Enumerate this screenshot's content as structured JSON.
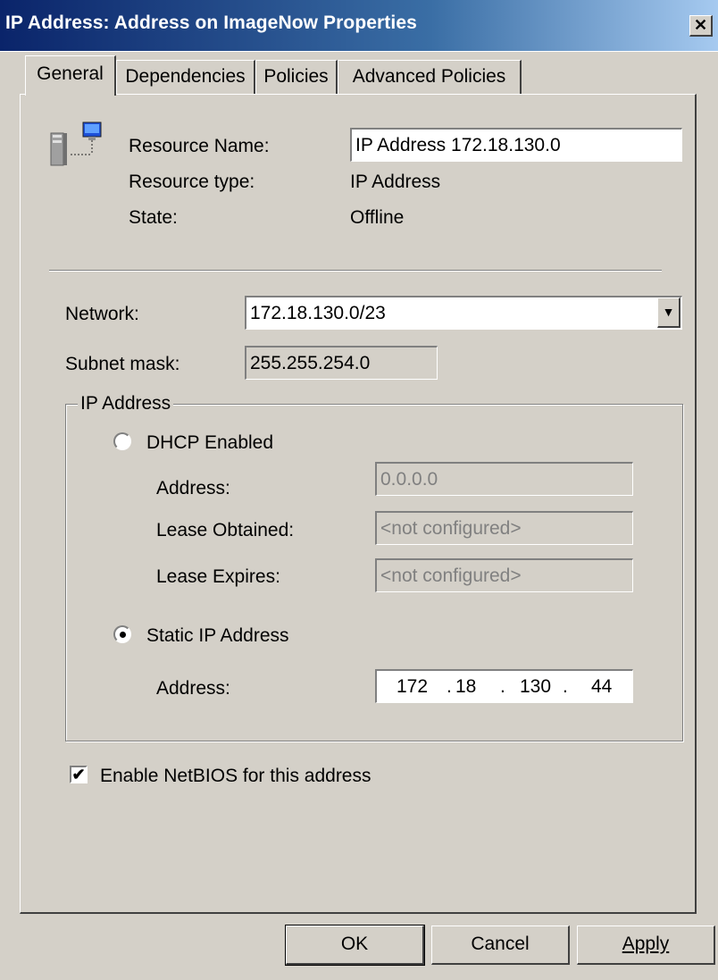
{
  "window": {
    "title": "IP Address: Address on ImageNow Properties",
    "close_label": "✕"
  },
  "tabs": [
    {
      "label": "General"
    },
    {
      "label": "Dependencies"
    },
    {
      "label": "Policies"
    },
    {
      "label": "Advanced Policies"
    }
  ],
  "resource": {
    "name_label": "Resource Name:",
    "name_value": "IP Address 172.18.130.0",
    "type_label": "Resource type:",
    "type_value": "IP Address",
    "state_label": "State:",
    "state_value": "Offline"
  },
  "network": {
    "label": "Network:",
    "value": "172.18.130.0/23",
    "subnet_label": "Subnet mask:",
    "subnet_value": "255.255.254.0"
  },
  "ip_group": {
    "title": "IP Address",
    "dhcp_label": "DHCP Enabled",
    "dhcp_selected": false,
    "dhcp_address_label": "Address:",
    "dhcp_address_value": "0.0.0.0",
    "lease_obtained_label": "Lease Obtained:",
    "lease_obtained_value": "<not configured>",
    "lease_expires_label": "Lease Expires:",
    "lease_expires_value": "<not configured>",
    "static_label": "Static IP Address",
    "static_selected": true,
    "static_address_label": "Address:",
    "octets": [
      "172",
      "18",
      "130",
      "44"
    ],
    "dot": "."
  },
  "netbios": {
    "label": "Enable NetBIOS for this address",
    "checked": true,
    "check_glyph": "✔"
  },
  "buttons": {
    "ok": "OK",
    "cancel": "Cancel",
    "apply": "Apply"
  },
  "icons": {
    "dropdown": "▼"
  }
}
